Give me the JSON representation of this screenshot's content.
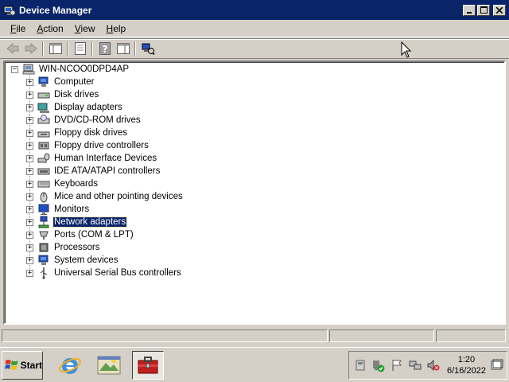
{
  "window": {
    "title": "Device Manager",
    "buttons": [
      "minimize-icon",
      "maximize-icon",
      "close-icon"
    ]
  },
  "menu": [
    {
      "label": "File",
      "key": "F",
      "rest": "ile"
    },
    {
      "label": "Action",
      "key": "A",
      "rest": "ction"
    },
    {
      "label": "View",
      "key": "V",
      "rest": "iew"
    },
    {
      "label": "Help",
      "key": "H",
      "rest": "elp"
    }
  ],
  "toolbar": {
    "buttons": [
      "back-icon",
      "forward-icon",
      "show-hide-console-tree-icon",
      "properties-icon",
      "help-icon",
      "action-pane-icon",
      "scan-hardware-icon"
    ]
  },
  "tree": {
    "root": {
      "label": "WIN-NCOO0DPD4AP",
      "icon": "computer-icon"
    },
    "items": [
      {
        "label": "Computer",
        "icon": "computer-icon"
      },
      {
        "label": "Disk drives",
        "icon": "disk-drive-icon"
      },
      {
        "label": "Display adapters",
        "icon": "display-adapter-icon"
      },
      {
        "label": "DVD/CD-ROM drives",
        "icon": "dvd-drive-icon"
      },
      {
        "label": "Floppy disk drives",
        "icon": "floppy-drive-icon"
      },
      {
        "label": "Floppy drive controllers",
        "icon": "floppy-controller-icon"
      },
      {
        "label": "Human Interface Devices",
        "icon": "hid-icon"
      },
      {
        "label": "IDE ATA/ATAPI controllers",
        "icon": "ide-controller-icon"
      },
      {
        "label": "Keyboards",
        "icon": "keyboard-icon"
      },
      {
        "label": "Mice and other pointing devices",
        "icon": "mouse-icon"
      },
      {
        "label": "Monitors",
        "icon": "monitor-icon"
      },
      {
        "label": "Network adapters",
        "icon": "network-adapter-icon",
        "selected": true
      },
      {
        "label": "Ports (COM & LPT)",
        "icon": "port-icon"
      },
      {
        "label": "Processors",
        "icon": "processor-icon"
      },
      {
        "label": "System devices",
        "icon": "system-device-icon"
      },
      {
        "label": "Universal Serial Bus controllers",
        "icon": "usb-icon"
      }
    ]
  },
  "taskbar": {
    "start_label": "Start",
    "quick_launch": [
      "internet-explorer-icon",
      "explorer-icon",
      "server-manager-icon"
    ],
    "tray_icons": [
      "usb-eject-icon",
      "security-icon",
      "flag-icon",
      "network-icon",
      "volume-muted-icon"
    ],
    "clock_time": "1:20",
    "clock_date": "6/16/2022"
  },
  "colors": {
    "titlebar": "#0a246a",
    "selection": "#0a246a",
    "face": "#d4d0c8"
  }
}
